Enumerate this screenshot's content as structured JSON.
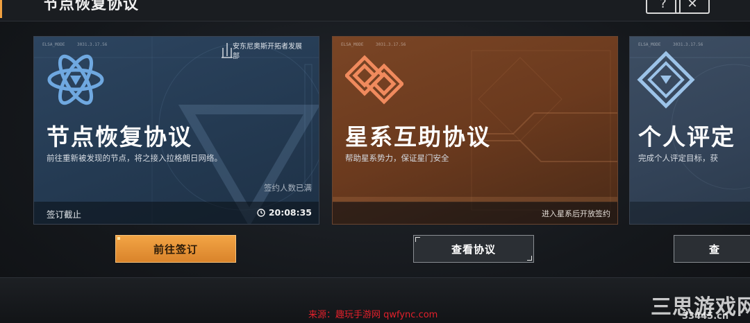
{
  "header": {
    "title": "节点恢复协议",
    "help_label": "?",
    "close_label": "✕"
  },
  "cards": [
    {
      "title": "节点恢复协议",
      "description": "前往重新被发现的节点，将之接入拉格朗日网络。",
      "corp_name": "安东尼奥斯开拓者发展部",
      "signed_status": "签约人数已满",
      "footer_left": "签订截止",
      "timer": "20:08:35",
      "icon": "atom-triangle-icon",
      "accent": "#5b9bd5"
    },
    {
      "title": "星系互助协议",
      "description": "帮助星系势力，保证星门安全",
      "footer_right": "进入星系后开放签约",
      "icon": "diamond-knot-icon",
      "accent": "#f08a5d"
    },
    {
      "title": "个人评定",
      "description": "完成个人评定目标，获",
      "icon": "diamond-shield-icon",
      "accent": "#9cc3e8"
    }
  ],
  "buttons": {
    "sign": "前往签订",
    "view": "查看协议",
    "partial": "查"
  },
  "watermark": {
    "source": "来源：趣玩手游网 qwfync.com",
    "site_name": "三思游戏网",
    "site_url": "33445.cn"
  }
}
